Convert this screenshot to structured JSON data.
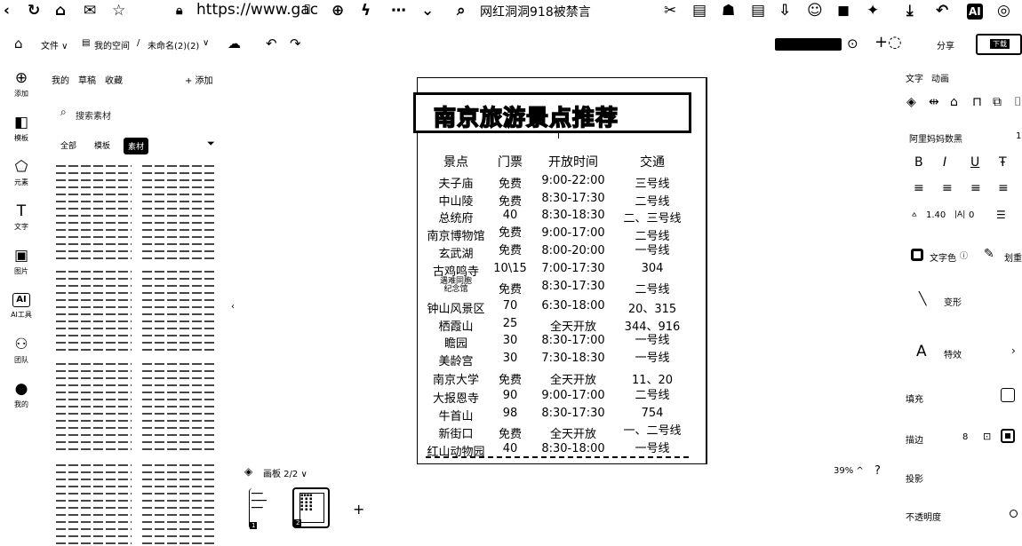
{
  "browser": {
    "url": "https://www.gac",
    "search_text": "网红洞洞918被禁言"
  },
  "app_toolbar": {
    "file_menu": "文件 ∨",
    "space_label": "我的空间",
    "separator": "/",
    "doc_name": "未命名(2)(2)",
    "share_label": "分享",
    "download_label": "下载"
  },
  "rail": [
    {
      "icon": "plus-circle-icon",
      "glyph": "⊕",
      "label": "添加"
    },
    {
      "icon": "template-icon",
      "glyph": "◧",
      "label": "模板"
    },
    {
      "icon": "element-icon",
      "glyph": "⬠",
      "label": "元素"
    },
    {
      "icon": "text-icon",
      "glyph": "T",
      "label": "文字"
    },
    {
      "icon": "image-icon",
      "glyph": "▣",
      "label": "图片"
    },
    {
      "icon": "ai-tool-icon",
      "glyph": "AI",
      "label": "AI工具"
    },
    {
      "icon": "team-icon",
      "glyph": "⚇",
      "label": "团队"
    },
    {
      "icon": "user-icon",
      "glyph": "●",
      "label": "我的"
    }
  ],
  "material_panel": {
    "tabs": [
      "我的",
      "草稿",
      "收藏"
    ],
    "add_label": "+ 添加",
    "search_placeholder": "搜索素材",
    "filters": [
      "全部",
      "模板",
      "素材"
    ]
  },
  "canvas": {
    "title": "南京旅游景点推荐",
    "headers": [
      "景点",
      "门票",
      "开放时间",
      "交通"
    ],
    "rows": [
      [
        "夫子庙",
        "免费",
        "9:00-22:00",
        "三号线"
      ],
      [
        "中山陵",
        "免费",
        "8:30-17:30",
        "二号线"
      ],
      [
        "总统府",
        "40",
        "8:30-18:30",
        "二、三号线"
      ],
      [
        "南京博物馆",
        "免费",
        "9:00-17:00",
        "二号线"
      ],
      [
        "玄武湖",
        "免费",
        "8:00-20:00",
        "一号线"
      ],
      [
        "古鸡鸣寺",
        "10\\15",
        "7:00-17:30",
        "304"
      ],
      [
        "遇难同胞\n纪念馆",
        "免费",
        "8:30-17:30",
        "二号线"
      ],
      [
        "钟山风景区",
        "70",
        "6:30-18:00",
        "20、315"
      ],
      [
        "栖霞山",
        "25",
        "全天开放",
        "344、916"
      ],
      [
        "瞻园",
        "30",
        "8:30-17:00",
        "一号线"
      ],
      [
        "美龄宫",
        "30",
        "7:30-18:30",
        "一号线"
      ],
      [
        "南京大学",
        "免费",
        "全天开放",
        "11、20"
      ],
      [
        "大报恩寺",
        "90",
        "9:00-17:00",
        "二号线"
      ],
      [
        "牛首山",
        "98",
        "8:30-17:30",
        "754"
      ],
      [
        "新街口",
        "免费",
        "全天开放",
        "一、二号线"
      ],
      [
        "红山动物园",
        "40",
        "8:30-18:00",
        "一号线"
      ]
    ]
  },
  "bottom_bar": {
    "pages_label": "画板 2/2 ∨",
    "page_numbers": [
      "1",
      "2"
    ],
    "zoom": "39% ^",
    "help": "?"
  },
  "right_panel": {
    "tabs": [
      "文字",
      "动画"
    ],
    "font_name": "阿里妈妈数黑",
    "line_height": "1.40",
    "letter_spacing": "0",
    "text_color_label": "文字色",
    "shape_label": "变形",
    "effect_label": "特效",
    "fill_label": "填充",
    "border_label": "描边",
    "border_width": "8",
    "shadow_label": "投影",
    "opacity_label": "不透明度"
  }
}
